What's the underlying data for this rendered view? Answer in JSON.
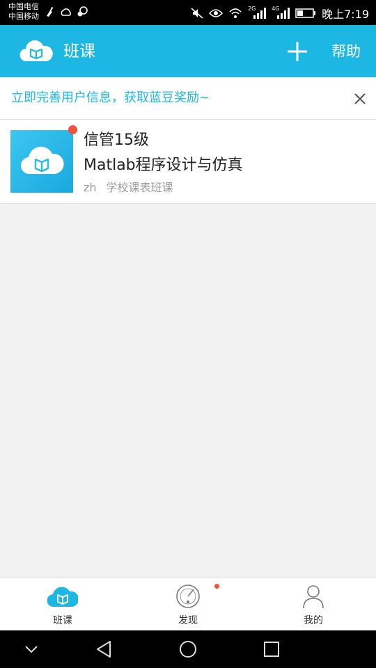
{
  "status_bar": {
    "carrier1": "中国电信",
    "carrier2": "中国移动",
    "net_2g": "2G",
    "net_4g": "4G",
    "time": "晚上7:19"
  },
  "app_bar": {
    "title": "班课",
    "help_label": "帮助",
    "icon_left": "cloud-book-logo-icon",
    "icon_add": "plus-icon"
  },
  "banner": {
    "text": "立即完善用户信息，获取蓝豆奖励~",
    "icon_close": "close-icon"
  },
  "courses": [
    {
      "class_name": "信管15级",
      "course_name": "Matlab程序设计与仿真",
      "teacher": "zh",
      "source": "学校课表班课",
      "has_unread": true
    }
  ],
  "tab_bar": {
    "items": [
      {
        "label": "班课",
        "icon": "cloud-book-icon",
        "active": true
      },
      {
        "label": "发现",
        "icon": "compass-icon",
        "badge": true
      },
      {
        "label": "我的",
        "icon": "person-icon"
      }
    ]
  },
  "nav_bar": {
    "icons": [
      "chevron-down-icon",
      "back-triangle-icon",
      "home-circle-icon",
      "recents-square-icon"
    ]
  },
  "colors": {
    "accent": "#1cb8e3",
    "badge": "#f0523c",
    "background": "#f2f2f2"
  }
}
